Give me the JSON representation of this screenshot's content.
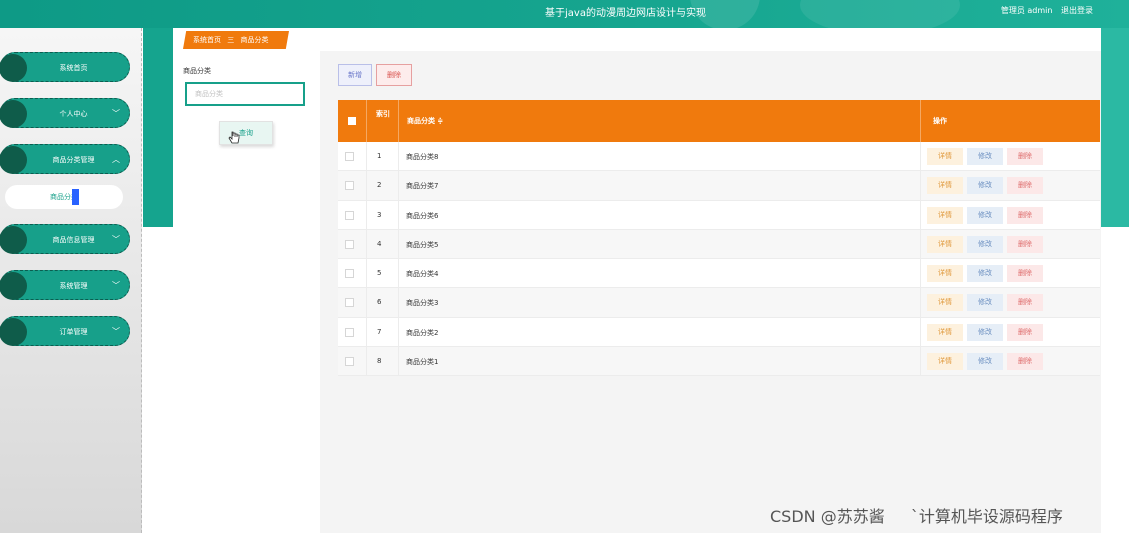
{
  "header": {
    "site_title": "基于java的动漫周边网店设计与实现",
    "user_role": "管理员 admin",
    "logout_label": "退出登录"
  },
  "sidebar": {
    "items": [
      {
        "label": "系统首页",
        "chevron": ""
      },
      {
        "label": "个人中心",
        "chevron": "﹀"
      },
      {
        "label": "商品分类管理",
        "chevron": "︿"
      },
      {
        "label": "商品信息管理",
        "chevron": "﹀"
      },
      {
        "label": "系统管理",
        "chevron": "﹀"
      },
      {
        "label": "订单管理",
        "chevron": "﹀"
      }
    ],
    "sub_item": "商品分类"
  },
  "breadcrumb": {
    "home": "系统首页",
    "separator": "三",
    "current": "商品分类"
  },
  "search": {
    "label": "商品分类",
    "placeholder": "商品分类",
    "query_label": "查询"
  },
  "toolbar": {
    "add_label": "新增",
    "delete_label": "删除"
  },
  "table": {
    "headers": {
      "index": "索引",
      "name": "商品分类 ≑",
      "operation": "操作"
    },
    "rows": [
      {
        "index": "1",
        "name": "商品分类8"
      },
      {
        "index": "2",
        "name": "商品分类7"
      },
      {
        "index": "3",
        "name": "商品分类6"
      },
      {
        "index": "4",
        "name": "商品分类5"
      },
      {
        "index": "5",
        "name": "商品分类4"
      },
      {
        "index": "6",
        "name": "商品分类3"
      },
      {
        "index": "7",
        "name": "商品分类2"
      },
      {
        "index": "8",
        "name": "商品分类1"
      }
    ],
    "row_actions": {
      "detail": "详情",
      "edit": "修改",
      "delete": "删除"
    }
  },
  "watermark": "CSDN @苏苏酱 　 ˋ计算机毕设源码程序",
  "colors": {
    "primary_teal": "#17a08a",
    "accent_orange": "#f07a0d"
  }
}
